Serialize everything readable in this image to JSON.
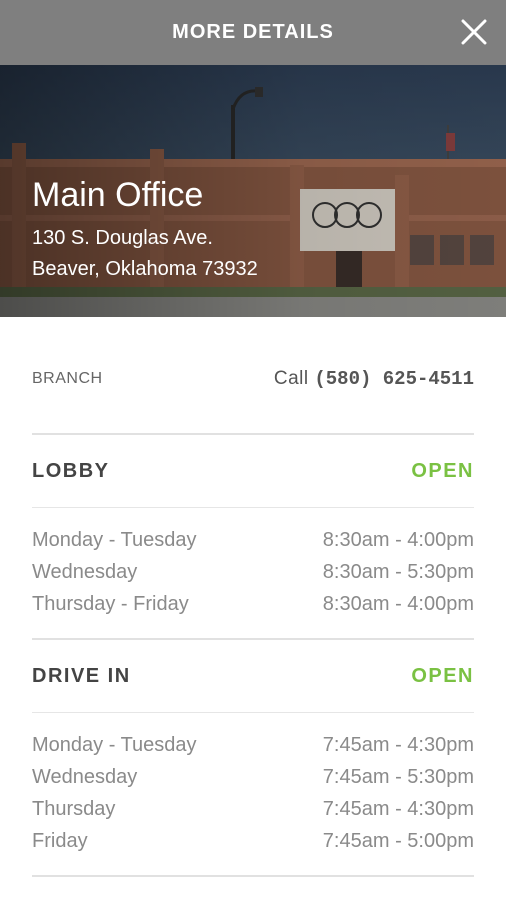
{
  "header": {
    "title": "MORE DETAILS",
    "close_icon": "close-icon"
  },
  "hero": {
    "title": "Main Office",
    "address_line1": "130 S. Douglas Ave.",
    "address_line2": "Beaver, Oklahoma 73932",
    "image": "bank-building-photo"
  },
  "branch": {
    "label": "BRANCH",
    "call_prefix": "Call",
    "phone": "(580) 625-4511"
  },
  "lobby": {
    "title": "LOBBY",
    "status": "OPEN",
    "hours": [
      {
        "days": "Monday - Tuesday",
        "time": "8:30am - 4:00pm"
      },
      {
        "days": "Wednesday",
        "time": "8:30am - 5:30pm"
      },
      {
        "days": "Thursday - Friday",
        "time": "8:30am - 4:00pm"
      }
    ]
  },
  "drive_in": {
    "title": "DRIVE IN",
    "status": "OPEN",
    "hours": [
      {
        "days": "Monday - Tuesday",
        "time": "7:45am - 4:30pm"
      },
      {
        "days": "Wednesday",
        "time": "7:45am - 5:30pm"
      },
      {
        "days": "Thursday",
        "time": "7:45am - 4:30pm"
      },
      {
        "days": "Friday",
        "time": "7:45am - 5:00pm"
      }
    ]
  },
  "colors": {
    "header_bg": "#7f7f7f",
    "open_green": "#7ac143",
    "divider": "#e1e1e1"
  }
}
